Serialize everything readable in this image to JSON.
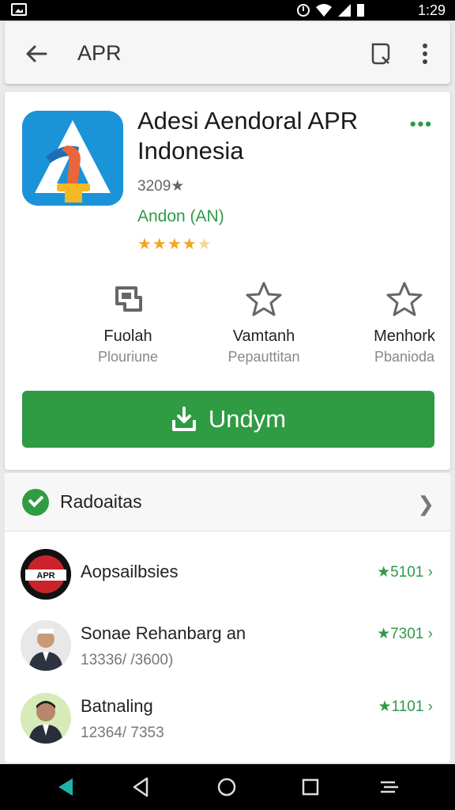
{
  "status_bar": {
    "time": "1:29",
    "icons": [
      "alarm-icon",
      "wifi-icon",
      "signal-icon",
      "battery-icon"
    ]
  },
  "app_bar": {
    "title": "APR",
    "icons": [
      "back-arrow-icon",
      "search-icon",
      "more-vert-icon"
    ]
  },
  "app": {
    "name_line1": "Adesi Aendoral APR",
    "name_line2": "Indonesia",
    "rating_count": "3209★",
    "developer": "Andon (AN)",
    "stars_full": "★★★★",
    "stars_half": "★",
    "more_label": "•••",
    "stats": [
      {
        "label": "Fuolah",
        "sub": "Plouriune",
        "icon": "download-box-icon"
      },
      {
        "label": "Vamtanh",
        "sub": "Pepauttitan",
        "icon": "star-outline-icon"
      },
      {
        "label": "Menhork",
        "sub": "Pbaniodа",
        "icon": "star-outline-icon"
      }
    ],
    "install_label": "Undym",
    "colors": {
      "accent": "#2f9b43",
      "star": "#f2a622",
      "icon_bg": "#1b93d8"
    }
  },
  "reviews": {
    "header": "Radoaitas",
    "items": [
      {
        "name": "Aopsailbsies",
        "meta": "",
        "score": "5101",
        "score_star": "★",
        "avatar_text": "APR"
      },
      {
        "name": "Sonae Rehanbarg an",
        "meta": "13336/ /3600)",
        "score": "7301",
        "score_star": "★",
        "avatar_text": ""
      },
      {
        "name": "Batnaling",
        "meta": "12364/ 7353",
        "score": "1101",
        "score_star": "★",
        "avatar_text": ""
      }
    ]
  }
}
